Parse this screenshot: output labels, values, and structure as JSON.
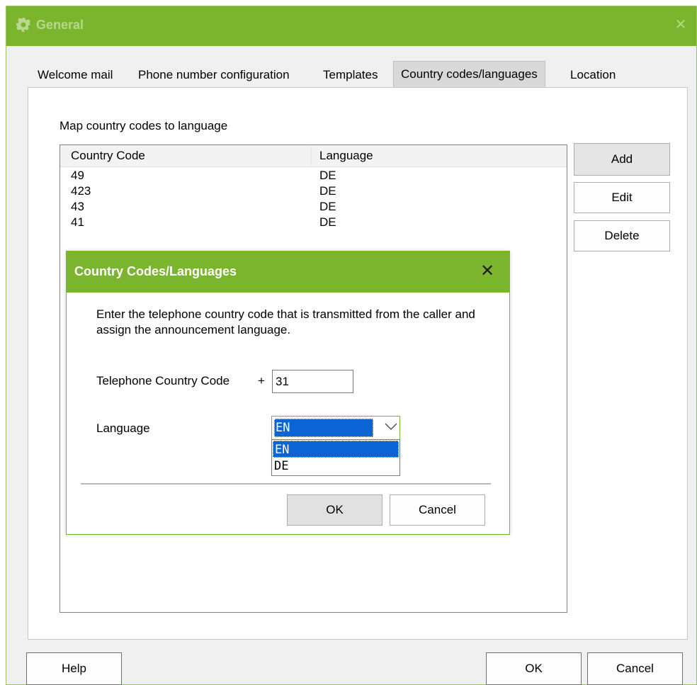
{
  "window": {
    "title": "General",
    "title_icon": "gear-icon",
    "close_icon": "close-icon",
    "accent_color": "#7bb42d"
  },
  "tabs": [
    {
      "label": "Welcome mail",
      "active": false
    },
    {
      "label": "Phone number configuration",
      "active": false
    },
    {
      "label": "Templates",
      "active": false
    },
    {
      "label": "Country codes/languages",
      "active": true
    },
    {
      "label": "Location",
      "active": false
    }
  ],
  "panel": {
    "label": "Map country codes to language",
    "columns": [
      "Country Code",
      "Language"
    ],
    "rows": [
      {
        "code": "49",
        "language": "DE"
      },
      {
        "code": "423",
        "language": "DE"
      },
      {
        "code": "43",
        "language": "DE"
      },
      {
        "code": "41",
        "language": "DE"
      }
    ],
    "buttons": {
      "add": "Add",
      "edit": "Edit",
      "delete": "Delete"
    }
  },
  "dialog": {
    "title": "Country Codes/Languages",
    "close_icon": "close-icon",
    "description": "Enter the telephone country code that is transmitted from the caller and assign the announcement language.",
    "country_code_label": "Telephone Country Code",
    "plus": "+",
    "country_code_value": "31",
    "language_label": "Language",
    "language_selected": "EN",
    "language_options": [
      "EN",
      "DE"
    ],
    "ok": "OK",
    "cancel": "Cancel"
  },
  "footer": {
    "help": "Help",
    "ok": "OK",
    "cancel": "Cancel"
  }
}
